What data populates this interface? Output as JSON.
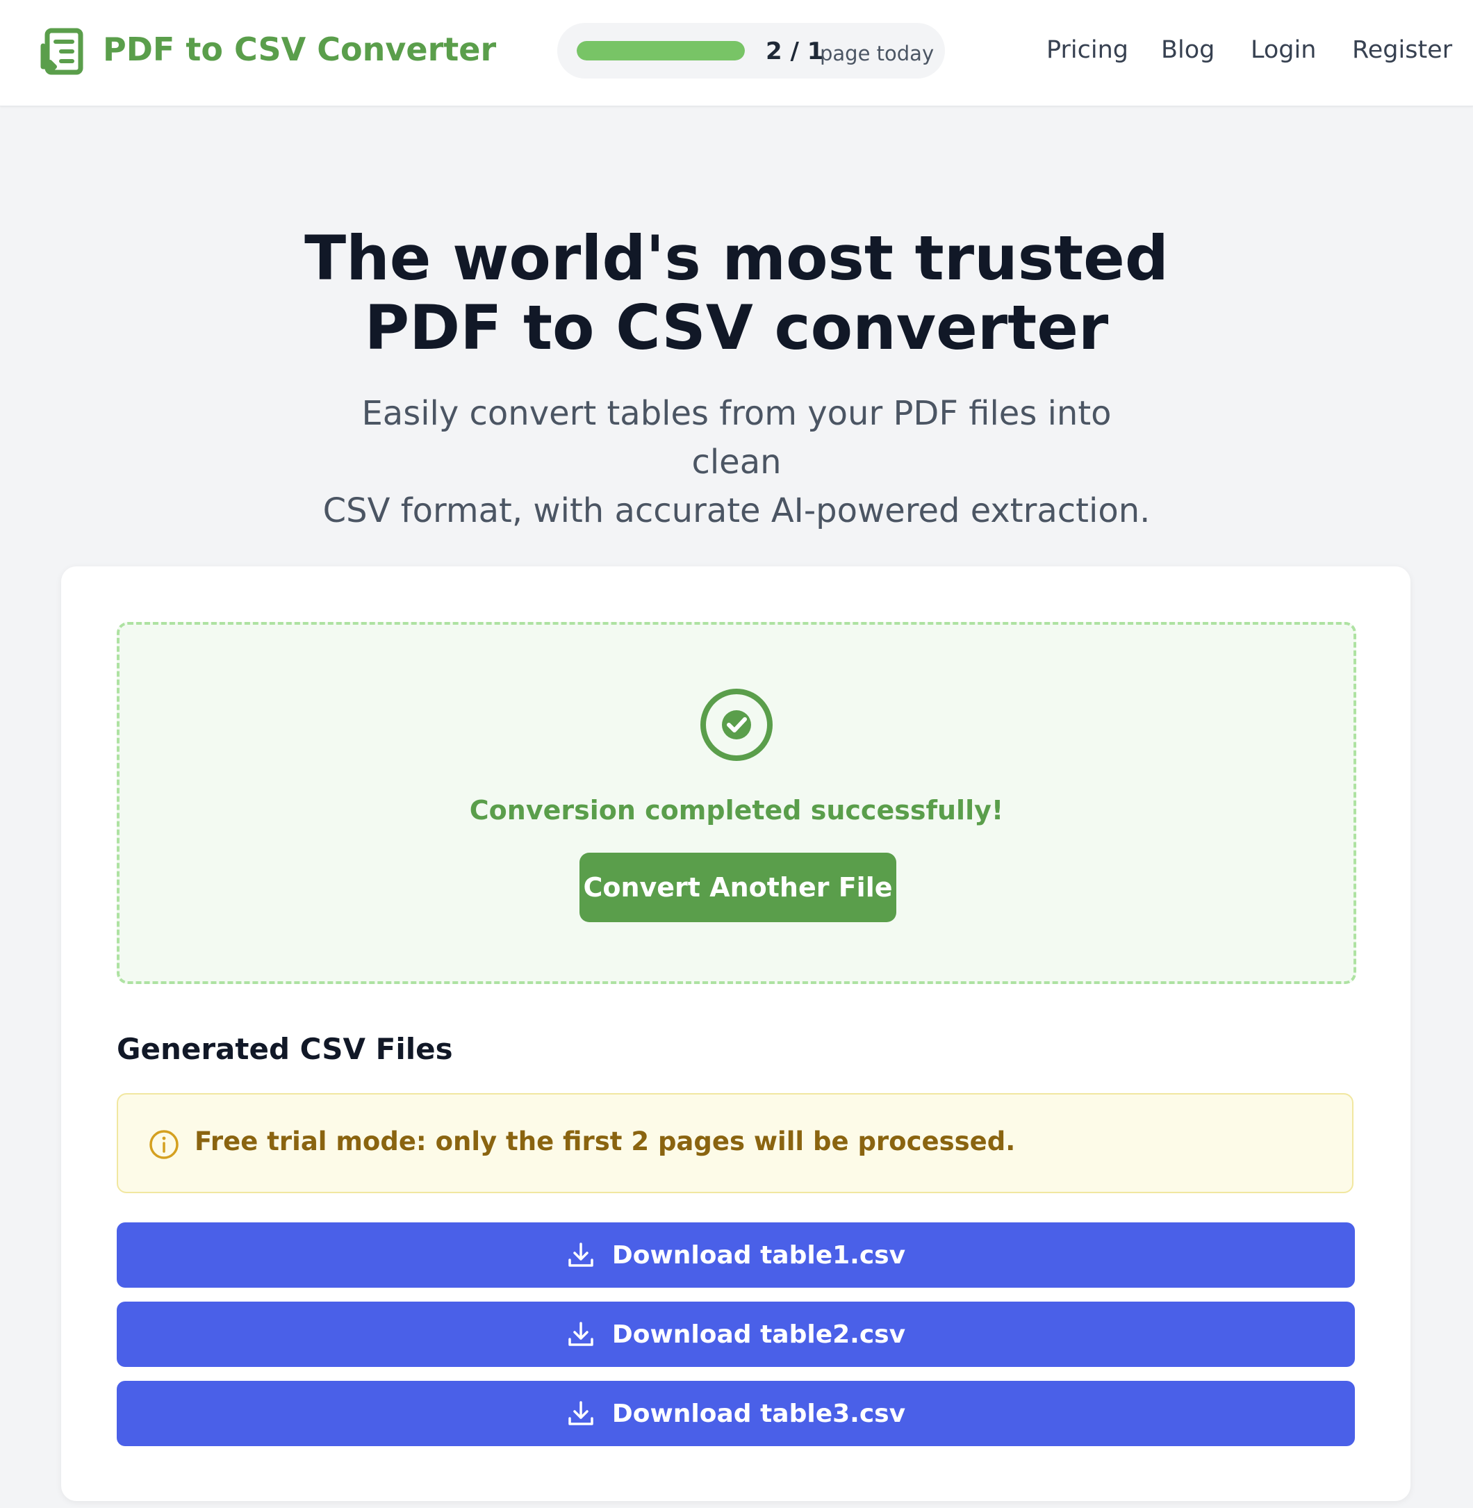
{
  "header": {
    "brand": "PDF to CSV Converter",
    "logo_icon": "document-convert-icon",
    "quota": {
      "count": "2 / 1",
      "unit": "page today",
      "progress_percent": 100
    },
    "nav": {
      "pricing": "Pricing",
      "blog": "Blog",
      "login": "Login",
      "register": "Register"
    }
  },
  "hero": {
    "title_line1": "The world's most trusted",
    "title_line2": "PDF to CSV converter",
    "subtitle_line1": "Easily convert tables from your PDF files into clean",
    "subtitle_line2": "CSV format, with accurate AI-powered extraction."
  },
  "result": {
    "status_icon": "check-circle-icon",
    "message": "Conversion completed successfully!",
    "convert_another": "Convert Another File"
  },
  "files": {
    "title": "Generated CSV Files",
    "notice_icon": "info-icon",
    "notice": "Free trial mode: only the first 2 pages will be processed.",
    "downloads": [
      {
        "label": "Download table1.csv"
      },
      {
        "label": "Download table2.csv"
      },
      {
        "label": "Download table3.csv"
      }
    ]
  },
  "colors": {
    "brand_green": "#5a9e4b",
    "progress_green": "#78c466",
    "download_blue": "#4a60e8",
    "notice_text": "#8a6410"
  }
}
